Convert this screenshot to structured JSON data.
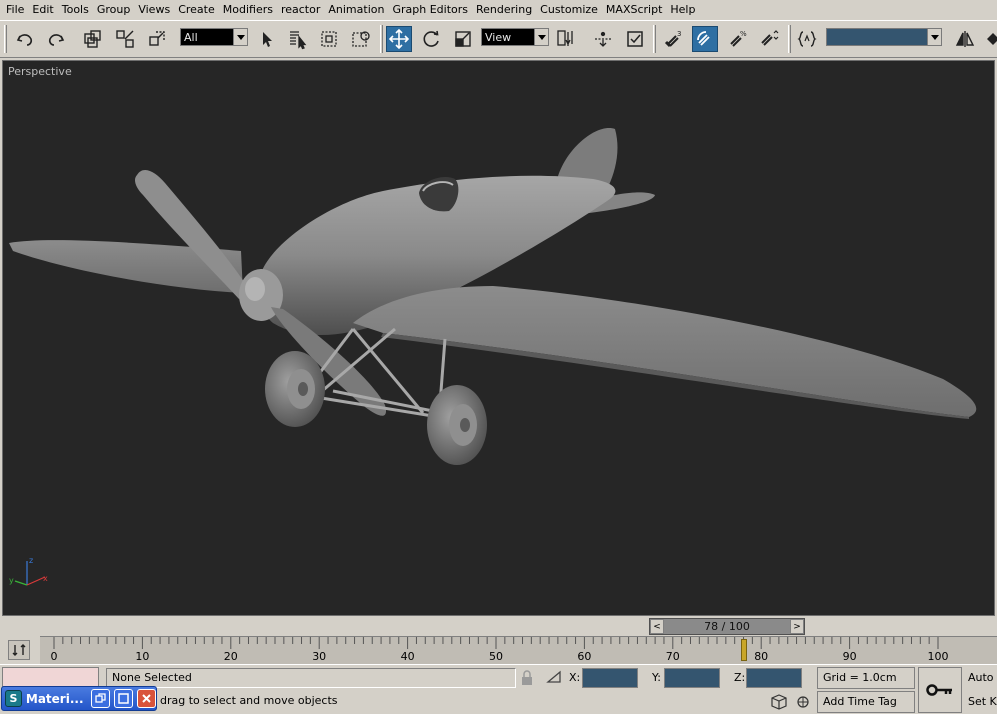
{
  "menu": [
    "File",
    "Edit",
    "Tools",
    "Group",
    "Views",
    "Create",
    "Modifiers",
    "reactor",
    "Animation",
    "Graph Editors",
    "Rendering",
    "Customize",
    "MAXScript",
    "Help"
  ],
  "toolbar": {
    "selection_filter": "All",
    "reference_coord": "View",
    "named_selection": ""
  },
  "viewport": {
    "label": "Perspective",
    "axis": {
      "x": "x",
      "y": "y",
      "z": "z"
    }
  },
  "time_slider": {
    "display": "78 / 100",
    "prev": "<",
    "next": ">",
    "current_frame": 78,
    "total_frames": 100
  },
  "trackbar": {
    "ticks": [
      "0",
      "10",
      "20",
      "30",
      "40",
      "50",
      "60",
      "70",
      "80",
      "90",
      "100"
    ]
  },
  "status": {
    "selection": "None Selected",
    "prompt": "drag to select and move objects",
    "x_label": "X:",
    "y_label": "Y:",
    "z_label": "Z:",
    "x_value": "",
    "y_value": "",
    "z_value": "",
    "grid": "Grid = 1.0cm",
    "time_tag": "Add Time Tag",
    "auto_key": "Auto K",
    "set_key": "Set K"
  },
  "minimized_window": {
    "title": "Materi..."
  },
  "colors": {
    "viewport_bg": "#262626",
    "active_tool": "#2e6fa3",
    "model_gray": "#8a8a8a",
    "time_marker": "#c9a628"
  }
}
